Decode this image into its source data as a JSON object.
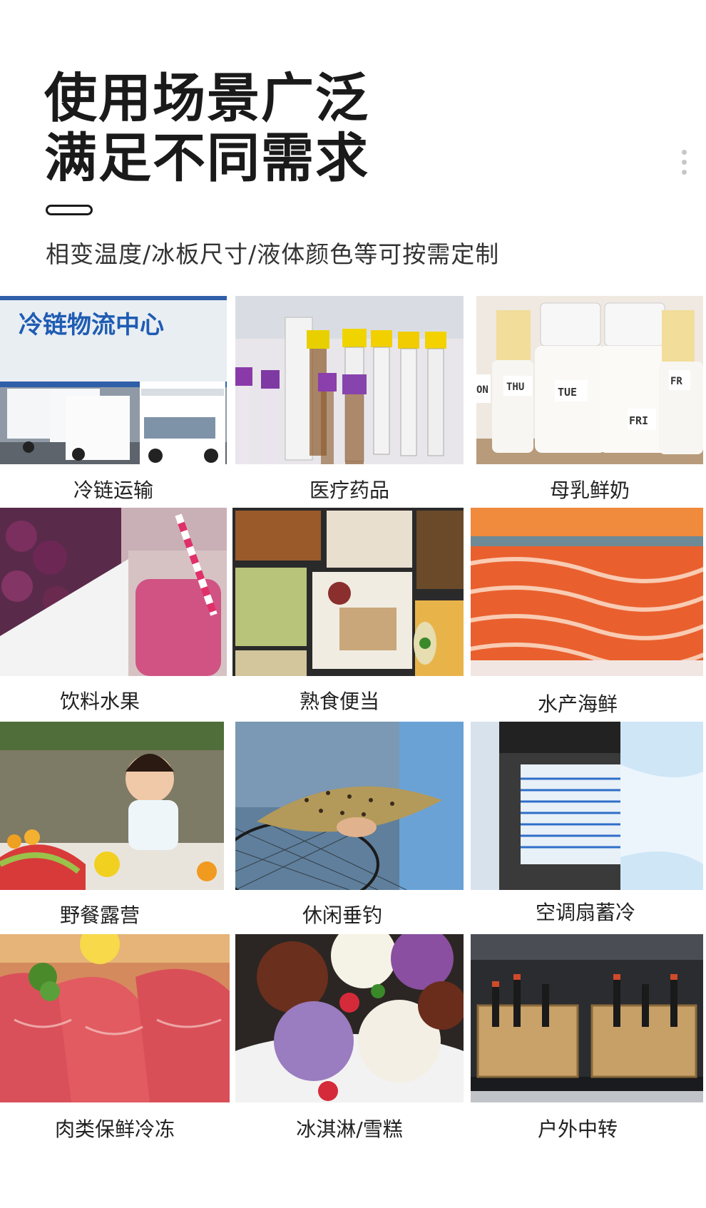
{
  "header": {
    "title_line1": "使用场景广泛",
    "title_line2": "满足不同需求",
    "subtitle": "相变温度/冰板尺寸/液体颜色等可按需定制"
  },
  "scenarios": [
    {
      "label": "冷链运输",
      "icon": "cold-chain-trucks-photo",
      "sign": "冷链物流中心"
    },
    {
      "label": "医疗药品",
      "icon": "medical-test-tubes-photo"
    },
    {
      "label": "母乳鲜奶",
      "icon": "breast-milk-bottles-photo",
      "tags": [
        "ON",
        "THU",
        "TUE",
        "FRI",
        "FR"
      ]
    },
    {
      "label": "饮料水果",
      "icon": "berry-drink-photo"
    },
    {
      "label": "熟食便当",
      "icon": "bento-box-photo"
    },
    {
      "label": "水产海鲜",
      "icon": "salmon-photo"
    },
    {
      "label": "野餐露营",
      "icon": "picnic-baby-photo"
    },
    {
      "label": "休闲垂钓",
      "icon": "fishing-trout-photo"
    },
    {
      "label": "空调扇蓄冷",
      "icon": "air-cooler-fan-photo"
    },
    {
      "label": "肉类保鲜冷冻",
      "icon": "raw-meat-photo"
    },
    {
      "label": "冰淇淋/雪糕",
      "icon": "ice-cream-photo"
    },
    {
      "label": "户外中转",
      "icon": "car-trunk-wine-photo"
    }
  ]
}
